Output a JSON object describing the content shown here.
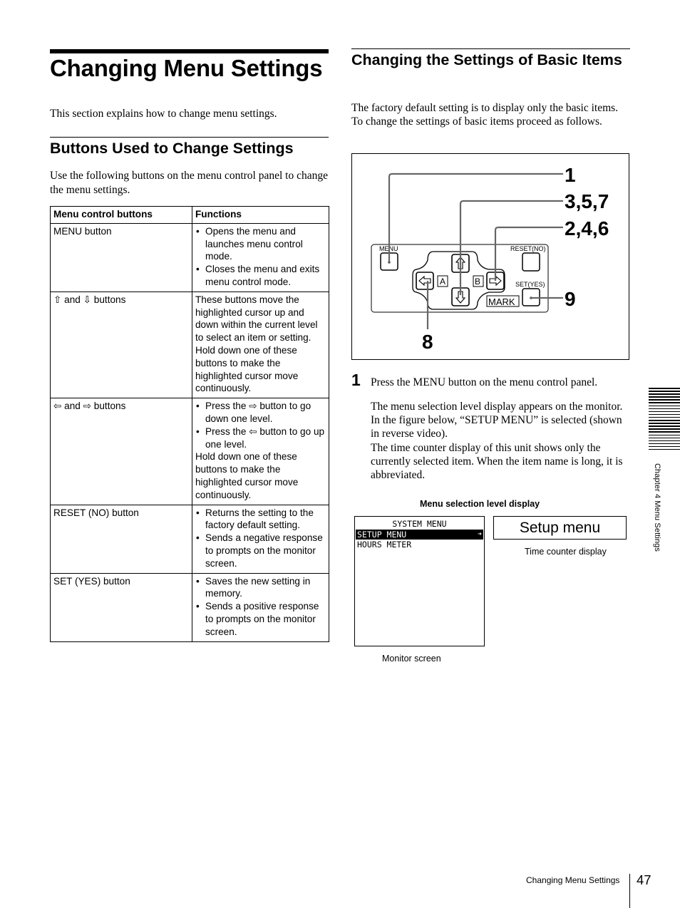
{
  "page": {
    "title": "Changing Menu Settings",
    "intro": "This section explains how to change menu settings.",
    "page_number": "47",
    "footer_label": "Changing Menu Settings",
    "side_tab_label": "Chapter 4  Menu Settings"
  },
  "section_buttons": {
    "heading": "Buttons Used to Change Settings",
    "body": "Use the following buttons on the menu control panel to change the menu settings.",
    "table": {
      "headers": [
        "Menu control buttons",
        "Functions"
      ],
      "rows": [
        {
          "button": "MENU button",
          "bullets": [
            "Opens the menu and launches menu control mode.",
            "Closes the menu and exits menu control mode."
          ],
          "note": ""
        },
        {
          "button": "⇧ and ⇩ buttons",
          "bullets": [],
          "note": "These buttons move the highlighted cursor up and down within the current level to select an item or setting. Hold down one of these buttons to make the highlighted cursor move continuously."
        },
        {
          "button": "⇦ and ⇨ buttons",
          "bullets": [
            "Press the ⇨ button to go down one level.",
            "Press the ⇦ button to go up one level."
          ],
          "note": "Hold down one of these buttons to make the highlighted cursor move continuously."
        },
        {
          "button": "RESET (NO) button",
          "bullets": [
            "Returns the setting to the factory default setting.",
            "Sends a negative response to prompts on the monitor screen."
          ],
          "note": ""
        },
        {
          "button": "SET (YES) button",
          "bullets": [
            "Saves the new setting in memory.",
            "Sends a positive response to prompts on the monitor screen."
          ],
          "note": ""
        }
      ]
    }
  },
  "section_basic": {
    "heading": "Changing the Settings of Basic Items",
    "body": "The factory default setting is to display only the basic items. To change the settings of basic items proceed as follows.",
    "diagram": {
      "panel_labels": {
        "menu": "MENU",
        "reset": "RESET(NO)",
        "set": "SET(YES)",
        "mark": "MARK",
        "a": "A",
        "b": "B"
      },
      "callouts": {
        "menu": "1",
        "up_down": "3,5,7",
        "right": "2,4,6",
        "set": "9",
        "left": "8"
      },
      "icons": [
        "up-arrow-icon",
        "down-arrow-icon",
        "left-arrow-icon",
        "right-arrow-icon"
      ]
    },
    "step": {
      "number": "1",
      "instruction": "Press the MENU button on the menu control panel.",
      "description": "The menu selection level display appears on the monitor. In the figure below, “SETUP MENU” is selected (shown in reverse video).",
      "description2": "The time counter display of this unit shows only the currently selected item. When the item name is long, it is abbreviated."
    },
    "figure": {
      "caption": "Menu selection level display",
      "monitor": {
        "title": "SYSTEM MENU",
        "selected_item": "SETUP MENU",
        "selected_arrow": "➔",
        "items": [
          "HOURS METER"
        ],
        "caption": "Monitor screen"
      },
      "time_counter": {
        "value": "Setup menu",
        "caption": "Time counter display"
      }
    }
  }
}
